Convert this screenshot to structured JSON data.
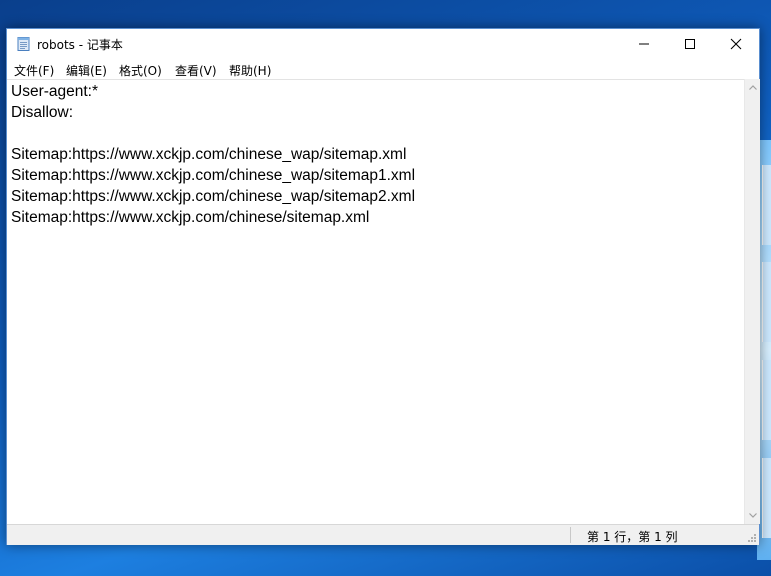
{
  "window": {
    "title": "robots - 记事本",
    "icon": "notepad-icon",
    "controls": {
      "minimize": "minimize-icon",
      "maximize": "maximize-icon",
      "close": "close-icon"
    }
  },
  "menu": [
    {
      "label": "文件(F)"
    },
    {
      "label": "编辑(E)"
    },
    {
      "label": "格式(O)"
    },
    {
      "label": "查看(V)"
    },
    {
      "label": "帮助(H)"
    }
  ],
  "document": {
    "lines": [
      "User-agent:*",
      "Disallow:",
      "",
      "Sitemap:https://www.xckjp.com/chinese_wap/sitemap.xml",
      "Sitemap:https://www.xckjp.com/chinese_wap/sitemap1.xml",
      "Sitemap:https://www.xckjp.com/chinese_wap/sitemap2.xml",
      "Sitemap:https://www.xckjp.com/chinese/sitemap.xml"
    ]
  },
  "status": {
    "position": "第 1 行，第 1 列"
  },
  "colors": {
    "desktop": "#0f5fc0",
    "window_border": "#5a8fd0",
    "statusbar": "#f0f0f0"
  }
}
